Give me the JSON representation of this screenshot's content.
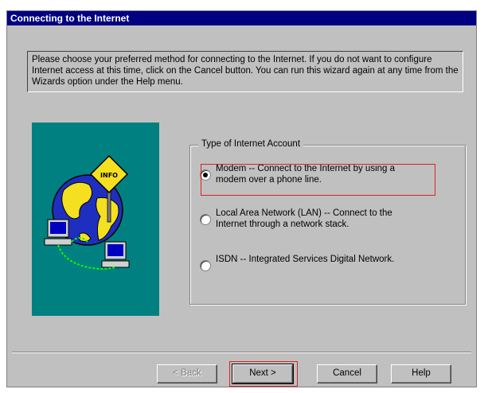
{
  "window": {
    "title": "Connecting to the Internet"
  },
  "intro_text": "Please choose your preferred method for connecting to the Internet. If you do not want to configure Internet access at this time, click on the Cancel button. You can run this wizard again at any time from the Wizards option under the Help menu.",
  "illustration": {
    "sign_text": "INFO"
  },
  "account_group": {
    "title": "Type of Internet Account",
    "options": [
      {
        "label": "Modem -- Connect to the Internet by using a modem over a phone line.",
        "selected": true
      },
      {
        "label": "Local Area Network (LAN) -- Connect to the Internet through a network stack.",
        "selected": false
      },
      {
        "label": "ISDN -- Integrated Services Digital Network.",
        "selected": false
      }
    ]
  },
  "buttons": {
    "back": "< Back",
    "next": "Next >",
    "cancel": "Cancel",
    "help": "Help"
  },
  "colors": {
    "titlebar": "#000080",
    "dialog": "#c0c0c0",
    "illustration_bg": "#008080",
    "highlight": "#e02020"
  }
}
